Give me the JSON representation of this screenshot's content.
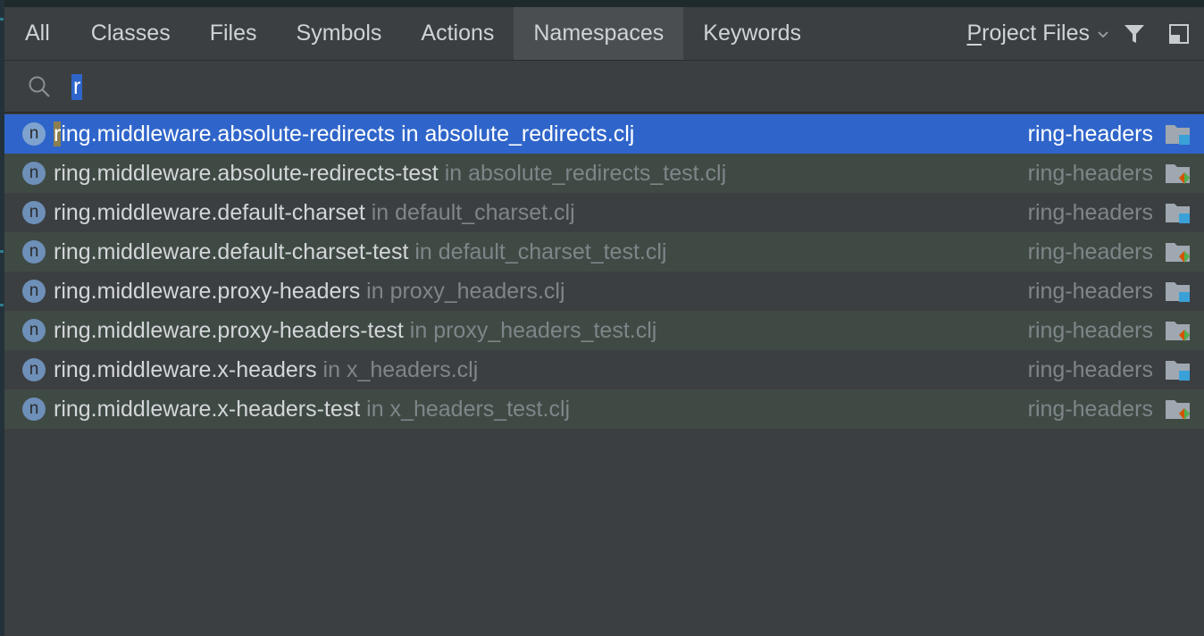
{
  "tabs": [
    {
      "label": "All",
      "active": false
    },
    {
      "label": "Classes",
      "active": false
    },
    {
      "label": "Files",
      "active": false
    },
    {
      "label": "Symbols",
      "active": false
    },
    {
      "label": "Actions",
      "active": false
    },
    {
      "label": "Namespaces",
      "active": true
    },
    {
      "label": "Keywords",
      "active": false
    }
  ],
  "toolbar": {
    "scope_first_letter": "P",
    "scope_rest": "roject Files",
    "scope_chevron_icon": "chevron-down-icon",
    "filter_icon": "filter-icon",
    "preview_icon": "preview-panel-icon"
  },
  "search": {
    "icon": "search-icon",
    "query": "r"
  },
  "results": [
    {
      "match": "r",
      "name_rest": "ing.middleware.absolute-redirects",
      "location": "in absolute_redirects.clj",
      "module": "ring-headers",
      "kind": "source",
      "selected": true
    },
    {
      "match": "",
      "name_rest": "ring.middleware.absolute-redirects-test",
      "location": "in absolute_redirects_test.clj",
      "module": "ring-headers",
      "kind": "test",
      "selected": false
    },
    {
      "match": "",
      "name_rest": "ring.middleware.default-charset",
      "location": "in default_charset.clj",
      "module": "ring-headers",
      "kind": "source",
      "selected": false
    },
    {
      "match": "",
      "name_rest": "ring.middleware.default-charset-test",
      "location": "in default_charset_test.clj",
      "module": "ring-headers",
      "kind": "test",
      "selected": false
    },
    {
      "match": "",
      "name_rest": "ring.middleware.proxy-headers",
      "location": "in proxy_headers.clj",
      "module": "ring-headers",
      "kind": "source",
      "selected": false
    },
    {
      "match": "",
      "name_rest": "ring.middleware.proxy-headers-test",
      "location": "in proxy_headers_test.clj",
      "module": "ring-headers",
      "kind": "test",
      "selected": false
    },
    {
      "match": "",
      "name_rest": "ring.middleware.x-headers",
      "location": "in x_headers.clj",
      "module": "ring-headers",
      "kind": "source",
      "selected": false
    },
    {
      "match": "",
      "name_rest": "ring.middleware.x-headers-test",
      "location": "in x_headers_test.clj",
      "module": "ring-headers",
      "kind": "test",
      "selected": false
    }
  ],
  "namespace_badge": "n",
  "colors": {
    "panel": "#3c3f41",
    "active_tab": "#4b4e51",
    "selection": "#2f65ca",
    "test_row": "#3f4a44",
    "match_highlight": "#8c7f4e",
    "source_folder_marker": "#3aa0d8",
    "test_folder_marker_a": "#d35400",
    "test_folder_marker_b": "#4caf50"
  }
}
